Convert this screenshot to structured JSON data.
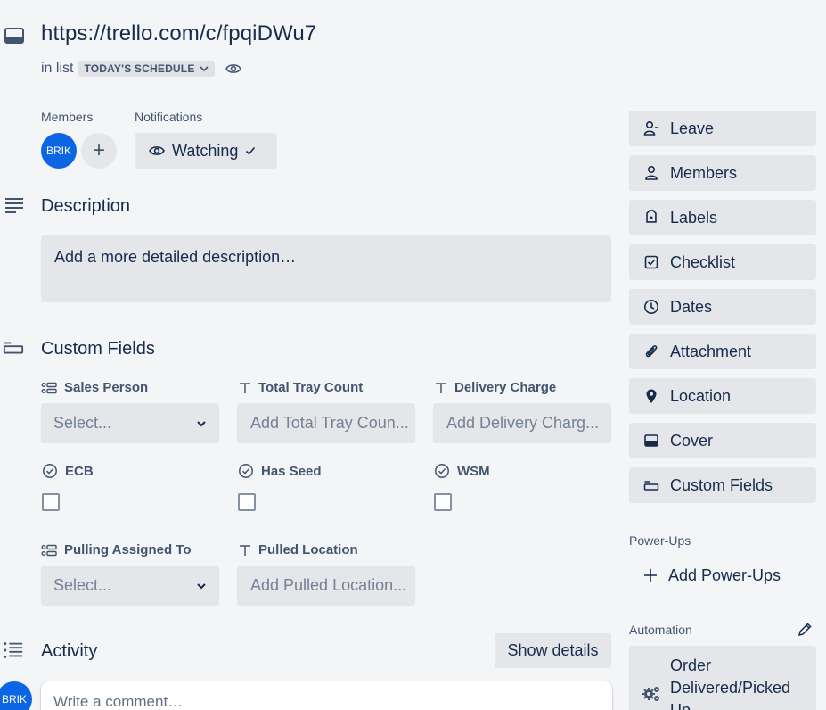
{
  "card": {
    "title": "https://trello.com/c/fpqiDWu7",
    "in_list_prefix": "in list",
    "list_name": "TODAY'S SCHEDULE"
  },
  "members": {
    "label": "Members",
    "avatar_initials": "BRIK",
    "add_symbol": "+"
  },
  "notifications": {
    "label": "Notifications",
    "watch_label": "Watching"
  },
  "description": {
    "title": "Description",
    "placeholder": "Add a more detailed description…"
  },
  "custom_fields": {
    "title": "Custom Fields",
    "fields": [
      {
        "label": "Sales Person",
        "type": "dropdown",
        "value": "Select..."
      },
      {
        "label": "Total Tray Count",
        "type": "text",
        "placeholder": "Add Total Tray Coun..."
      },
      {
        "label": "Delivery Charge",
        "type": "text",
        "placeholder": "Add Delivery Charg..."
      },
      {
        "label": "ECB",
        "type": "checkbox"
      },
      {
        "label": "Has Seed",
        "type": "checkbox"
      },
      {
        "label": "WSM",
        "type": "checkbox"
      },
      {
        "label": "Pulling Assigned To",
        "type": "dropdown",
        "value": "Select..."
      },
      {
        "label": "Pulled Location",
        "type": "text",
        "placeholder": "Add Pulled Location..."
      }
    ]
  },
  "activity": {
    "title": "Activity",
    "show_details": "Show details",
    "comment_placeholder": "Write a comment…",
    "avatar_initials": "BRIK"
  },
  "sidebar": {
    "buttons": [
      {
        "label": "Leave",
        "icon": "leave-icon"
      },
      {
        "label": "Members",
        "icon": "person-icon"
      },
      {
        "label": "Labels",
        "icon": "tag-icon"
      },
      {
        "label": "Checklist",
        "icon": "checklist-icon"
      },
      {
        "label": "Dates",
        "icon": "clock-icon"
      },
      {
        "label": "Attachment",
        "icon": "paperclip-icon"
      },
      {
        "label": "Location",
        "icon": "location-pin-icon"
      },
      {
        "label": "Cover",
        "icon": "cover-icon"
      },
      {
        "label": "Custom Fields",
        "icon": "custom-fields-icon"
      }
    ],
    "powerups_heading": "Power-Ups",
    "add_powerups": "Add Power-Ups",
    "automation_heading": "Automation",
    "automation_line1": "Order",
    "automation_line2": "Delivered/Picked",
    "automation_line3": "Up"
  },
  "colors": {
    "background": "#f4f5f7",
    "button_bg": "#e4e6ea",
    "avatar_blue": "#0c66e4",
    "text": "#172b4d",
    "subtle_text": "#44546f"
  }
}
